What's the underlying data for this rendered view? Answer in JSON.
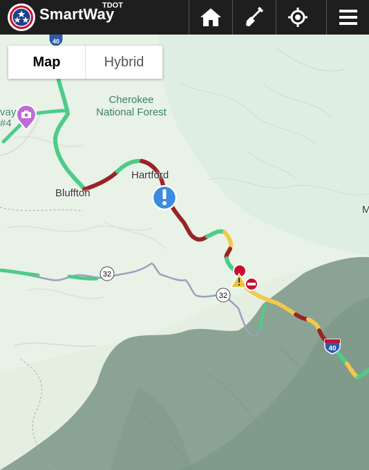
{
  "header": {
    "brand": "SmartWay",
    "brand_sub": "TDOT",
    "nav": [
      {
        "icon": "home-icon"
      },
      {
        "icon": "shovel-icon"
      },
      {
        "icon": "locate-icon"
      },
      {
        "icon": "menu-icon"
      }
    ]
  },
  "map_type": {
    "options": [
      "Map",
      "Hybrid"
    ],
    "selected": "Map"
  },
  "labels": {
    "forest": "Cherokee National Forest",
    "forest_line1": "Cherokee",
    "forest_line2": "National Forest",
    "hartford": "Hartford",
    "bluffton": "Bluffton",
    "edge_left_1": "vay",
    "edge_left_2": "#4",
    "edge_right": "M"
  },
  "shields": {
    "i40": "40",
    "route32": "32"
  },
  "markers": {
    "info": {
      "icon": "info-icon"
    },
    "camera": {
      "icon": "camera-icon"
    },
    "incident": {
      "icon": "warning-icon"
    },
    "closure": {
      "icon": "road-closed-icon"
    }
  },
  "colors": {
    "header": "#1e1e1e",
    "flow_good": "#4ecb8a",
    "flow_slow": "#f2c94c",
    "flow_heavy": "#9b2226",
    "info_marker": "#3d8be0",
    "camera_marker": "#c06ad8"
  }
}
